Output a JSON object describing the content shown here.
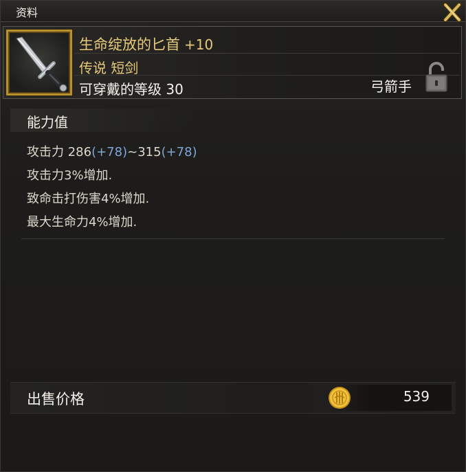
{
  "window": {
    "title": "资料"
  },
  "item": {
    "name": "生命绽放的匕首",
    "enhance": "+10",
    "rarity_type": "传说 短剑",
    "level_req": "可穿戴的等级 30",
    "class": "弓箭手",
    "icon": "dagger-icon",
    "lock_icon": "lock-icon"
  },
  "stats": {
    "section_title": "能力值",
    "attack_label": "攻击力 286",
    "attack_bonus1": "(+78)",
    "attack_mid": "~315",
    "attack_bonus2": "(+78)",
    "lines": [
      "攻击力3%增加.",
      "致命击打伤害4%增加.",
      "最大生命力4%增加."
    ]
  },
  "price": {
    "label": "出售价格",
    "value": "539",
    "icon": "gold-coin-icon"
  },
  "colors": {
    "gold_text": "#e6c97a",
    "blue_bonus": "#7fa6d6",
    "frame_gold": "#b7902f",
    "background": "#1c1b19"
  }
}
